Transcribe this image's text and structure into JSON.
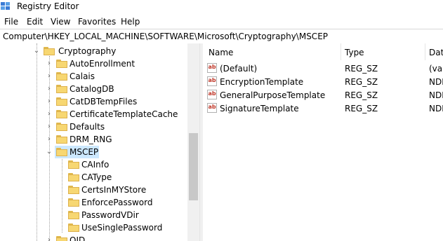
{
  "window": {
    "title": "Registry Editor",
    "icon": "registry-editor-icon"
  },
  "menu": [
    "File",
    "Edit",
    "View",
    "Favorites",
    "Help"
  ],
  "address": "Computer\\HKEY_LOCAL_MACHINE\\SOFTWARE\\Microsoft\\Cryptography\\MSCEP",
  "tree": {
    "parent": {
      "label": "Cryptography",
      "expanded": true
    },
    "children": [
      {
        "label": "AutoEnrollment",
        "expandable": true
      },
      {
        "label": "Calais",
        "expandable": true
      },
      {
        "label": "CatalogDB",
        "expandable": true
      },
      {
        "label": "CatDBTempFiles",
        "expandable": true
      },
      {
        "label": "CertificateTemplateCache",
        "expandable": true
      },
      {
        "label": "Defaults",
        "expandable": true
      },
      {
        "label": "DRM_RNG",
        "expandable": true
      },
      {
        "label": "MSCEP",
        "expanded": true,
        "selected": true
      }
    ],
    "subkeys": [
      "CAInfo",
      "CAType",
      "CertsInMYStore",
      "EnforcePassword",
      "PasswordVDir",
      "UseSinglePassword"
    ],
    "partial_next": "OID"
  },
  "list": {
    "columns": {
      "name": "Name",
      "type": "Type",
      "data": "Data"
    },
    "rows": [
      {
        "name": "(Default)",
        "type": "REG_SZ",
        "data": "(val"
      },
      {
        "name": "EncryptionTemplate",
        "type": "REG_SZ",
        "data": "NDE"
      },
      {
        "name": "GeneralPurposeTemplate",
        "type": "REG_SZ",
        "data": "NDE"
      },
      {
        "name": "SignatureTemplate",
        "type": "REG_SZ",
        "data": "NDE"
      }
    ]
  },
  "colors": {
    "selection": "#cce8ff",
    "folder": "#f7d772",
    "string_icon": "#c0392b"
  }
}
